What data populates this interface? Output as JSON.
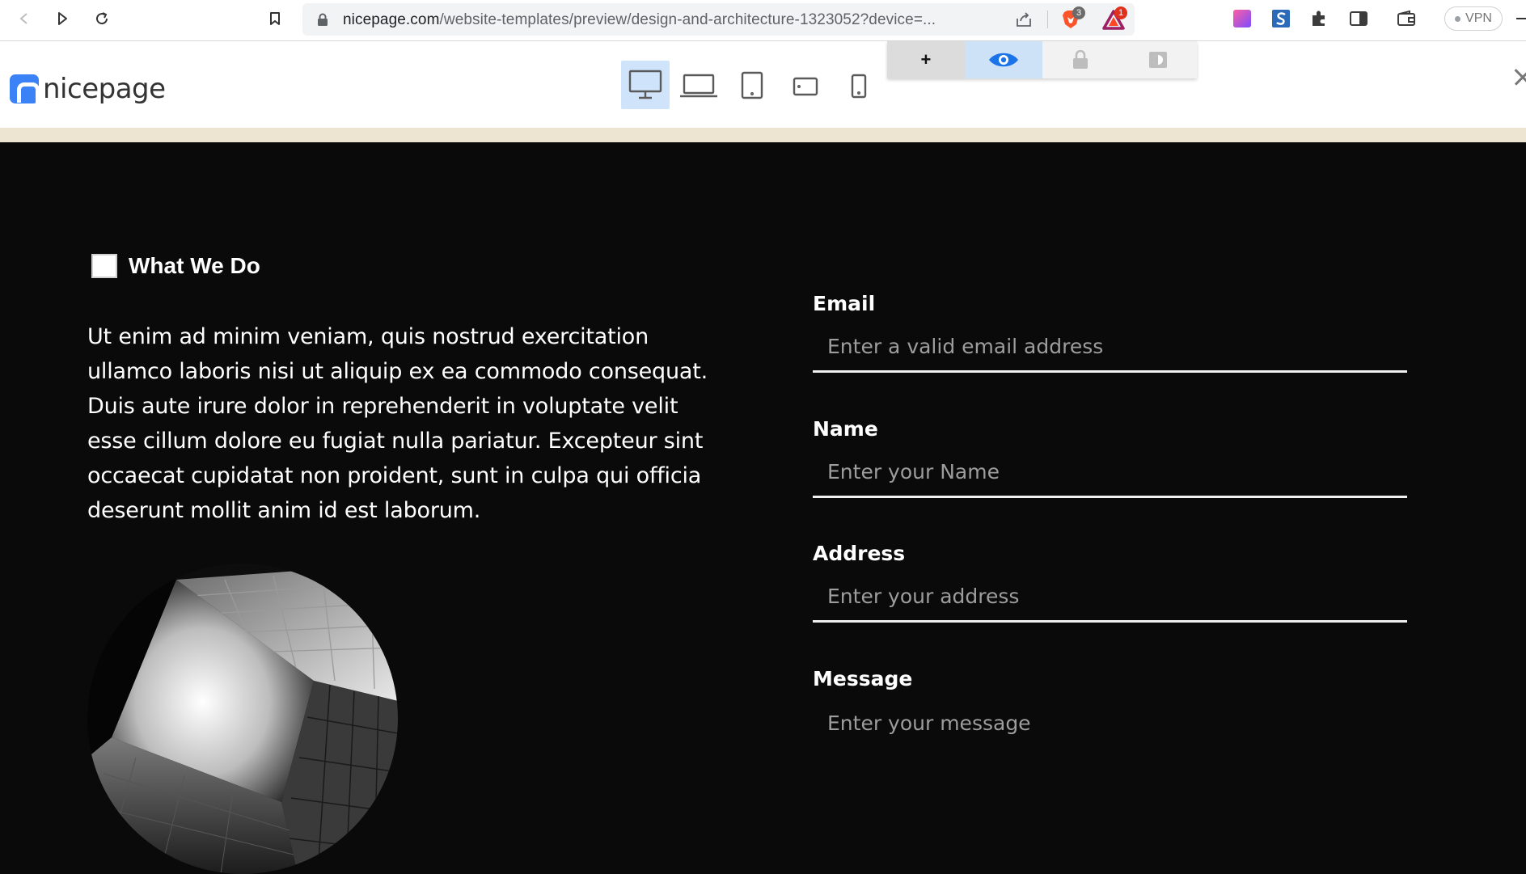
{
  "browser": {
    "url_domain": "nicepage.com",
    "url_path": "/website-templates/preview/design-and-architecture-1323052?device=...",
    "brave_badge": "3",
    "rewards_badge": "1",
    "vpn_label": "VPN"
  },
  "toolbar": {
    "logo_text": "nicepage",
    "devices": [
      "desktop",
      "laptop",
      "tablet",
      "tablet-landscape",
      "phone"
    ],
    "active_device": "desktop",
    "add_label": "+",
    "active_mode": "preview"
  },
  "section": {
    "heading": "What We Do",
    "body": "Ut enim ad minim veniam, quis nostrud exercitation ullamco laboris nisi ut aliquip ex ea commodo consequat. Duis aute irure dolor in reprehenderit in voluptate velit esse cillum dolore eu fugiat nulla pariatur. Excepteur sint occaecat cupidatat non proident, sunt in culpa qui officia deserunt mollit anim id est laborum."
  },
  "form": {
    "email": {
      "label": "Email",
      "placeholder": "Enter a valid email address",
      "value": ""
    },
    "name": {
      "label": "Name",
      "placeholder": "Enter your Name",
      "value": ""
    },
    "address": {
      "label": "Address",
      "placeholder": "Enter your address",
      "value": ""
    },
    "message": {
      "label": "Message",
      "placeholder": "Enter your message",
      "value": ""
    }
  },
  "colors": {
    "page_bg": "#0a0a0a",
    "accent_blue": "#3b82f6",
    "active_device_bg": "#cfe4fb",
    "beige_strip": "#eee4d2"
  }
}
